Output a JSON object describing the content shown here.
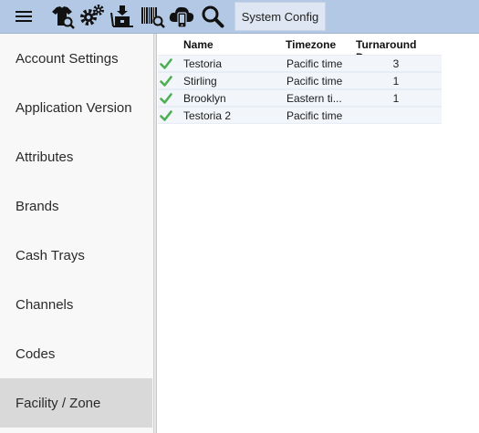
{
  "toolbar": {
    "icons": [
      "menu-icon",
      "shirt-search-icon",
      "gears-icon",
      "box-dolly-icon",
      "barcode-search-icon",
      "cloud-mobile-icon",
      "search-icon"
    ],
    "title_tab": "System Config"
  },
  "sidebar": {
    "items": [
      {
        "label": "Account Settings"
      },
      {
        "label": "Application Version"
      },
      {
        "label": "Attributes"
      },
      {
        "label": "Brands"
      },
      {
        "label": "Cash Trays"
      },
      {
        "label": "Channels"
      },
      {
        "label": "Codes"
      },
      {
        "label": "Facility / Zone"
      }
    ],
    "active_label": "Facility / Zone"
  },
  "grid": {
    "columns": {
      "name": "Name",
      "timezone": "Timezone",
      "turnaround": "Turnaround Days"
    },
    "rows": [
      {
        "status": "check-icon",
        "name": "Testoria",
        "timezone": "Pacific time",
        "turnaround": "3"
      },
      {
        "status": "check-icon",
        "name": "Stirling",
        "timezone": "Pacific time",
        "turnaround": "1"
      },
      {
        "status": "check-icon",
        "name": "Brooklyn",
        "timezone": "Eastern ti...",
        "turnaround": "1"
      },
      {
        "status": "check-icon",
        "name": "Testoria 2",
        "timezone": "Pacific time",
        "turnaround": ""
      }
    ]
  },
  "colors": {
    "toolbar_bg": "#b3c8e4",
    "tab_bg": "#dde6f2",
    "sidebar_bg": "#f8f8f8",
    "sidebar_active": "#d9d9d9",
    "row_bg": "#f2f6fb",
    "check": "#4caf50"
  }
}
